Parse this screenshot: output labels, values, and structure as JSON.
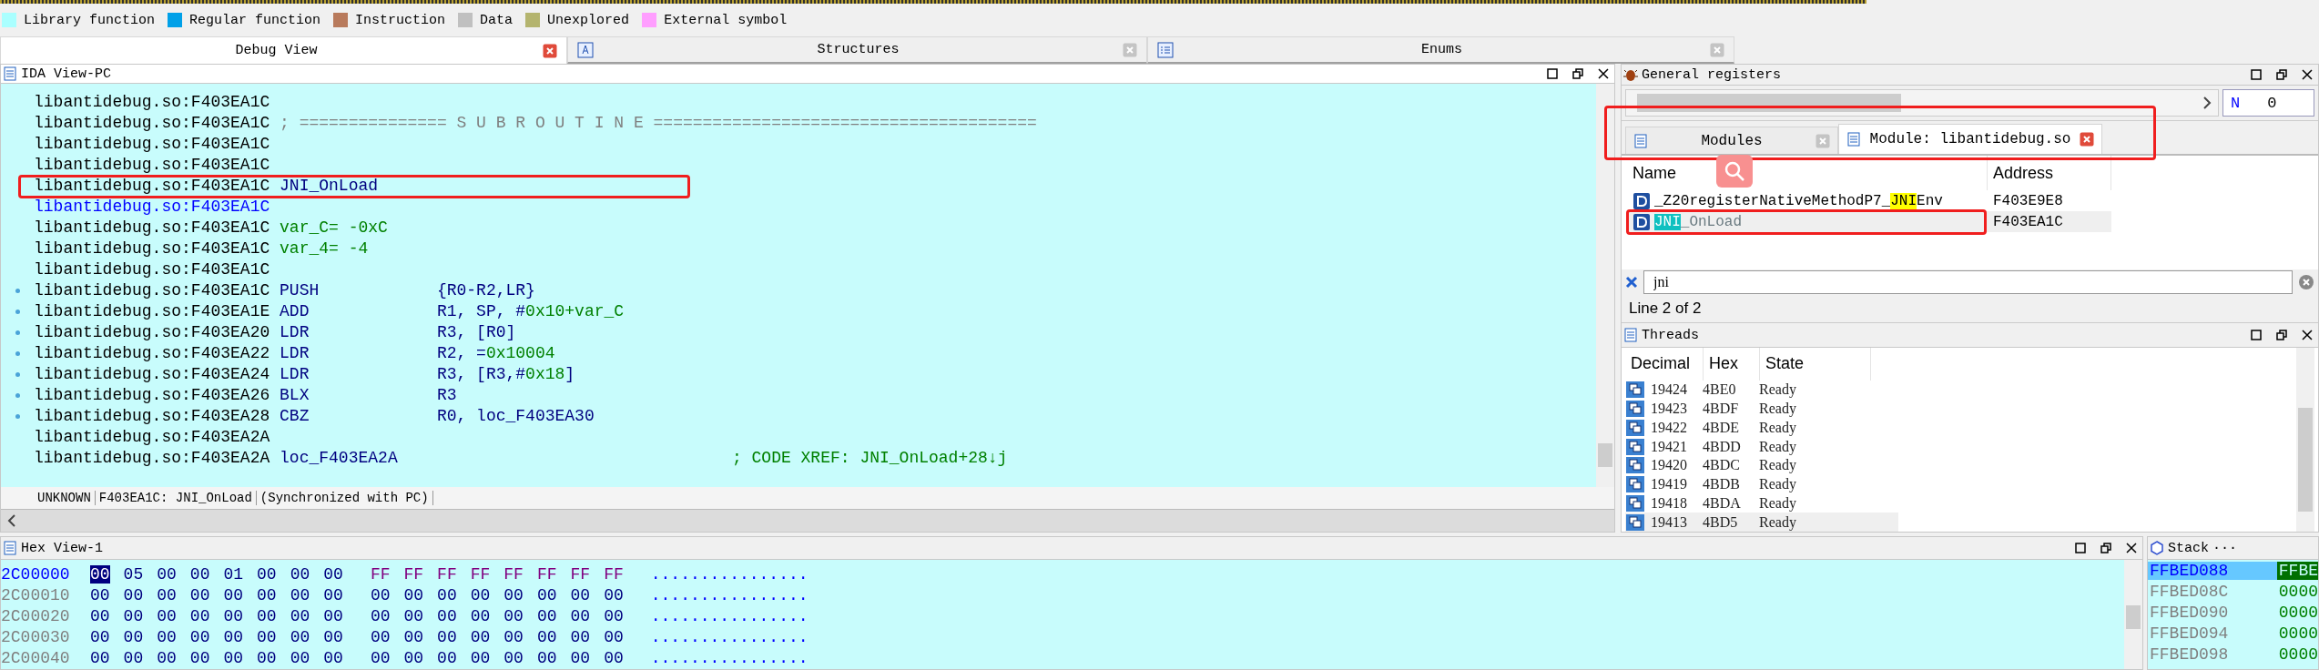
{
  "legend": [
    {
      "label": "Library function",
      "color": "#aaffff"
    },
    {
      "label": "Regular function",
      "color": "#00a0e8"
    },
    {
      "label": "Instruction",
      "color": "#b87a5c"
    },
    {
      "label": "Data",
      "color": "#c0c0c0"
    },
    {
      "label": "Unexplored",
      "color": "#b4b46e"
    },
    {
      "label": "External symbol",
      "color": "#ff9eff"
    }
  ],
  "main_tabs": [
    {
      "label": "Debug View",
      "selected": true
    },
    {
      "label": "Structures",
      "selected": false
    },
    {
      "label": "Enums",
      "selected": false
    }
  ],
  "ida_view": {
    "title": "IDA View-PC",
    "lines": [
      {
        "address": "libantidebug.so:F403EA1C",
        "bullet": false,
        "kind": "plain"
      },
      {
        "address": "libantidebug.so:F403EA1C",
        "bullet": false,
        "kind": "comment",
        "text": "; =============== S U B R O U T I N E ======================================="
      },
      {
        "address": "libantidebug.so:F403EA1C",
        "bullet": false,
        "kind": "plain"
      },
      {
        "address": "libantidebug.so:F403EA1C",
        "bullet": false,
        "kind": "plain"
      },
      {
        "address": "libantidebug.so:F403EA1C",
        "bullet": false,
        "kind": "label",
        "text": "JNI_OnLoad"
      },
      {
        "address": "libantidebug.so:F403EA1C",
        "bullet": false,
        "kind": "xref"
      },
      {
        "address": "libantidebug.so:F403EA1C",
        "bullet": false,
        "kind": "var",
        "text": "var_C= -0xC"
      },
      {
        "address": "libantidebug.so:F403EA1C",
        "bullet": false,
        "kind": "var",
        "text": "var_4= -4"
      },
      {
        "address": "libantidebug.so:F403EA1C",
        "bullet": false,
        "kind": "plain"
      },
      {
        "address": "libantidebug.so:F403EA1C",
        "bullet": true,
        "kind": "instr",
        "mnemonic": "PUSH",
        "operands": [
          {
            "text": "{R0-R2,LR}",
            "kind": "reg"
          }
        ]
      },
      {
        "address": "libantidebug.so:F403EA1E",
        "bullet": true,
        "kind": "instr",
        "mnemonic": "ADD",
        "operands": [
          {
            "text": "R1, SP, #",
            "kind": "reg"
          },
          {
            "text": "0x10+var_C",
            "kind": "num"
          }
        ]
      },
      {
        "address": "libantidebug.so:F403EA20",
        "bullet": true,
        "kind": "instr",
        "mnemonic": "LDR",
        "operands": [
          {
            "text": "R3, [R0]",
            "kind": "reg"
          }
        ]
      },
      {
        "address": "libantidebug.so:F403EA22",
        "bullet": true,
        "kind": "instr",
        "mnemonic": "LDR",
        "operands": [
          {
            "text": "R2, =",
            "kind": "reg"
          },
          {
            "text": "0x10004",
            "kind": "num"
          }
        ]
      },
      {
        "address": "libantidebug.so:F403EA24",
        "bullet": true,
        "kind": "instr",
        "mnemonic": "LDR",
        "operands": [
          {
            "text": "R3, [R3,#",
            "kind": "reg"
          },
          {
            "text": "0x18",
            "kind": "num"
          },
          {
            "text": "]",
            "kind": "reg"
          }
        ]
      },
      {
        "address": "libantidebug.so:F403EA26",
        "bullet": true,
        "kind": "instr",
        "mnemonic": "BLX",
        "operands": [
          {
            "text": "R3",
            "kind": "reg"
          }
        ]
      },
      {
        "address": "libantidebug.so:F403EA28",
        "bullet": true,
        "kind": "instr",
        "mnemonic": "CBZ",
        "operands": [
          {
            "text": "R0, loc_F403EA30",
            "kind": "reg"
          }
        ]
      },
      {
        "address": "libantidebug.so:F403EA2A",
        "bullet": false,
        "kind": "plain"
      },
      {
        "address": "libantidebug.so:F403EA2A",
        "bullet": false,
        "kind": "loc",
        "text": "loc_F403EA2A",
        "comment": "; CODE XREF: JNI_OnLoad+28↓j"
      }
    ],
    "status": {
      "segment": "UNKNOWN",
      "location": "F403EA1C: JNI_OnLoad",
      "sync": "(Synchronized with PC)"
    }
  },
  "registers": {
    "title": "General registers",
    "flag": "N",
    "flag_value": "0"
  },
  "module_tabs": [
    {
      "label": "Modules",
      "selected": false
    },
    {
      "label": "Module: libantidebug.so",
      "selected": true
    }
  ],
  "module_list": {
    "columns": [
      "Name",
      "Address"
    ],
    "rows": [
      {
        "name_before": "_Z20registerNativeMethodP7_",
        "match": "JNI",
        "name_after": "Env",
        "address": "F403E9E8",
        "selected": false
      },
      {
        "name_before": "",
        "match": "JNI",
        "name_after": "_OnLoad",
        "address": "F403EA1C",
        "selected": true
      }
    ]
  },
  "filter": {
    "value": "jni",
    "count": "Line 2 of 2"
  },
  "threads": {
    "title": "Threads",
    "columns": [
      "Decimal",
      "Hex",
      "State"
    ],
    "rows": [
      {
        "decimal": "19424",
        "hex": "4BE0",
        "state": "Ready",
        "selected": false
      },
      {
        "decimal": "19423",
        "hex": "4BDF",
        "state": "Ready",
        "selected": false
      },
      {
        "decimal": "19422",
        "hex": "4BDE",
        "state": "Ready",
        "selected": false
      },
      {
        "decimal": "19421",
        "hex": "4BDD",
        "state": "Ready",
        "selected": false
      },
      {
        "decimal": "19420",
        "hex": "4BDC",
        "state": "Ready",
        "selected": false
      },
      {
        "decimal": "19419",
        "hex": "4BDB",
        "state": "Ready",
        "selected": false
      },
      {
        "decimal": "19418",
        "hex": "4BDA",
        "state": "Ready",
        "selected": false
      },
      {
        "decimal": "19413",
        "hex": "4BD5",
        "state": "Ready",
        "selected": true
      }
    ]
  },
  "hex_view": {
    "title": "Hex View-1",
    "rows": [
      {
        "address": "2C00000",
        "current": true,
        "cursor_on_first_byte": true,
        "bytes_low": [
          "00",
          "05",
          "00",
          "00",
          "01",
          "00",
          "00",
          "00"
        ],
        "bytes_high": [
          "FF",
          "FF",
          "FF",
          "FF",
          "FF",
          "FF",
          "FF",
          "FF"
        ],
        "ascii": "................"
      },
      {
        "address": "2C00010",
        "current": false,
        "cursor_on_first_byte": false,
        "bytes_low": [
          "00",
          "00",
          "00",
          "00",
          "00",
          "00",
          "00",
          "00"
        ],
        "bytes_high": [
          "00",
          "00",
          "00",
          "00",
          "00",
          "00",
          "00",
          "00"
        ],
        "ascii": "................"
      },
      {
        "address": "2C00020",
        "current": false,
        "cursor_on_first_byte": false,
        "bytes_low": [
          "00",
          "00",
          "00",
          "00",
          "00",
          "00",
          "00",
          "00"
        ],
        "bytes_high": [
          "00",
          "00",
          "00",
          "00",
          "00",
          "00",
          "00",
          "00"
        ],
        "ascii": "................"
      },
      {
        "address": "2C00030",
        "current": false,
        "cursor_on_first_byte": false,
        "bytes_low": [
          "00",
          "00",
          "00",
          "00",
          "00",
          "00",
          "00",
          "00"
        ],
        "bytes_high": [
          "00",
          "00",
          "00",
          "00",
          "00",
          "00",
          "00",
          "00"
        ],
        "ascii": "................"
      },
      {
        "address": "2C00040",
        "current": false,
        "cursor_on_first_byte": false,
        "bytes_low": [
          "00",
          "00",
          "00",
          "00",
          "00",
          "00",
          "00",
          "00"
        ],
        "bytes_high": [
          "00",
          "00",
          "00",
          "00",
          "00",
          "00",
          "00",
          "00"
        ],
        "ascii": "................"
      }
    ]
  },
  "stack": {
    "title": "Stack",
    "more": "···",
    "rows": [
      {
        "address": "FFBED088",
        "value": "FFBE",
        "selected": true
      },
      {
        "address": "FFBED08C",
        "value": "0000",
        "selected": false
      },
      {
        "address": "FFBED090",
        "value": "0000",
        "selected": false
      },
      {
        "address": "FFBED094",
        "value": "0000",
        "selected": false
      },
      {
        "address": "FFBED098",
        "value": "0000",
        "selected": false
      }
    ]
  }
}
